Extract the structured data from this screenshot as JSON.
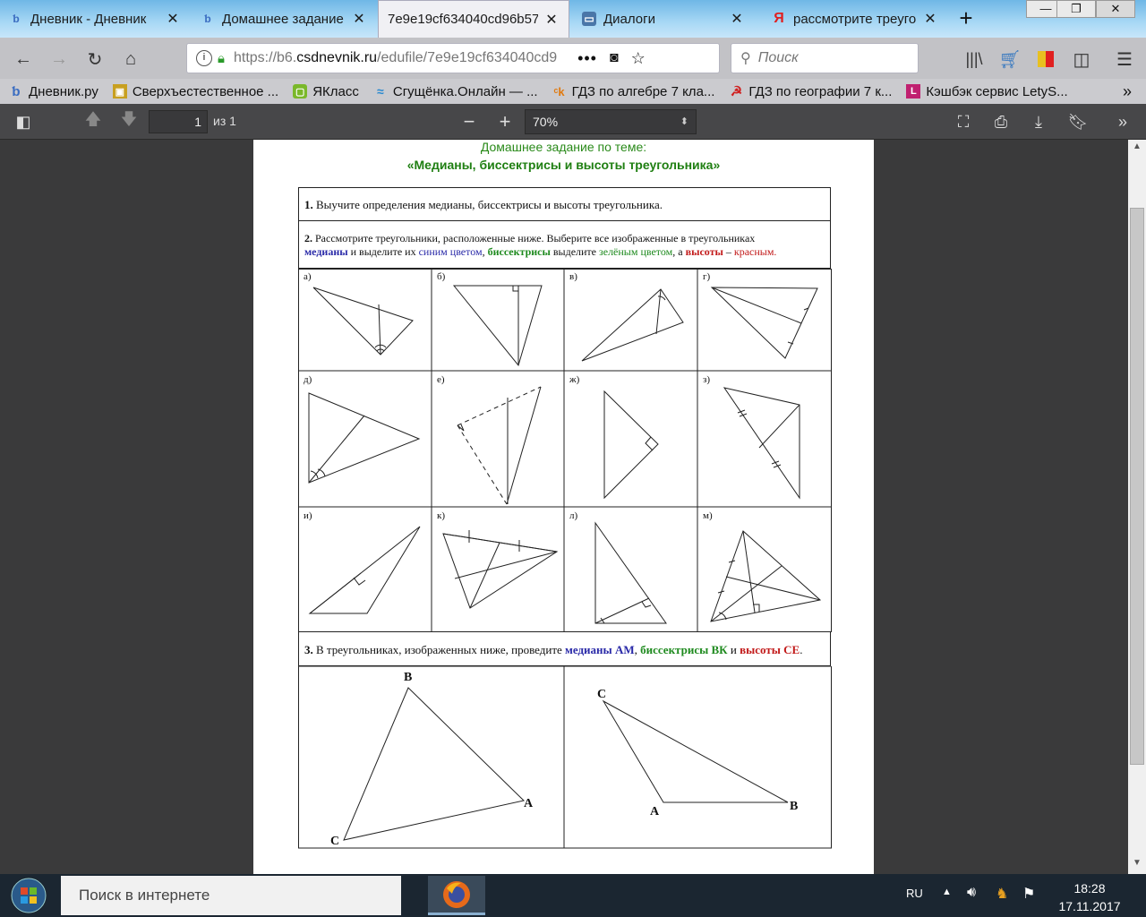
{
  "browser": {
    "tabs": [
      {
        "label": "Дневник - Дневник",
        "icon": "dnevnik-icon"
      },
      {
        "label": "Домашнее задание",
        "icon": "dnevnik-icon"
      },
      {
        "label": "7e9e19cf634040cd96b57",
        "icon": "pdf-icon"
      },
      {
        "label": "Диалоги",
        "icon": "vk-icon"
      },
      {
        "label": "рассмотрите треуго",
        "icon": "yandex-icon"
      }
    ],
    "new_tab": "+",
    "window_buttons": {
      "minimize": "—",
      "maximize": "❐",
      "close": "✕"
    },
    "url": {
      "scheme": "https://b6.",
      "host": "csdnevnik.ru",
      "path": "/edufile/7e9e19cf634040cd9"
    },
    "search_placeholder": "Поиск",
    "bookmarks": [
      {
        "label": "Дневник.ру",
        "color": "#3b6dc1"
      },
      {
        "label": "Сверхъестественное ...",
        "color": "#c8a020"
      },
      {
        "label": "ЯКласс",
        "color": "#7ab82a"
      },
      {
        "label": "Сгущёнка.Онлайн — ...",
        "color": "#2a8ad0"
      },
      {
        "label": "ГДЗ по алгебре 7 кла...",
        "color": "#e07a10"
      },
      {
        "label": "ГДЗ по географии 7 к...",
        "color": "#d02020"
      },
      {
        "label": "Кэшбэк сервис LetyS...",
        "color": "#c02070"
      }
    ]
  },
  "pdf_toolbar": {
    "page_current": "1",
    "page_count": "из 1",
    "zoom": "70%"
  },
  "document": {
    "heading1": "Домашнее задание по теме:",
    "heading2": "«Медианы, биссектрисы и высоты треугольника»",
    "q1_num": "1.",
    "q1_text": "Выучите определения медианы, биссектрисы и высоты треугольника.",
    "q2_num": "2.",
    "q2_line1": "Рассмотрите треугольники, расположенные ниже. Выберите все изображенные в треугольниках",
    "q2_medians": "медианы",
    "q2_t1": " и выделите их ",
    "q2_blue": "синим цветом",
    "q2_t2": ", ",
    "q2_bisectors": "биссектрисы",
    "q2_t3": " выделите ",
    "q2_green": "зелёным цветом",
    "q2_t4": ", а ",
    "q2_heights": "высоты",
    "q2_t5": " – ",
    "q2_red": "красным.",
    "cell_labels": [
      "а)",
      "б)",
      "в)",
      "г)",
      "д)",
      "е)",
      "ж)",
      "з)",
      "и)",
      "к)",
      "л)",
      "м)"
    ],
    "q3_num": "3.",
    "q3_t1": "В треугольниках, изображенных ниже, проведите ",
    "q3_medians": "медианы АМ",
    "q3_t2": ", ",
    "q3_bisectors": "биссектрисы ВК",
    "q3_t3": " и ",
    "q3_heights": "высоты СЕ",
    "q3_t4": ".",
    "tri1": {
      "b": "B",
      "a": "A",
      "c": "C"
    },
    "tri2": {
      "c": "C",
      "a": "A",
      "b": "B"
    }
  },
  "taskbar": {
    "search_placeholder": "Поиск в интернете",
    "lang": "RU",
    "time": "18:28",
    "date": "17.11.2017"
  }
}
